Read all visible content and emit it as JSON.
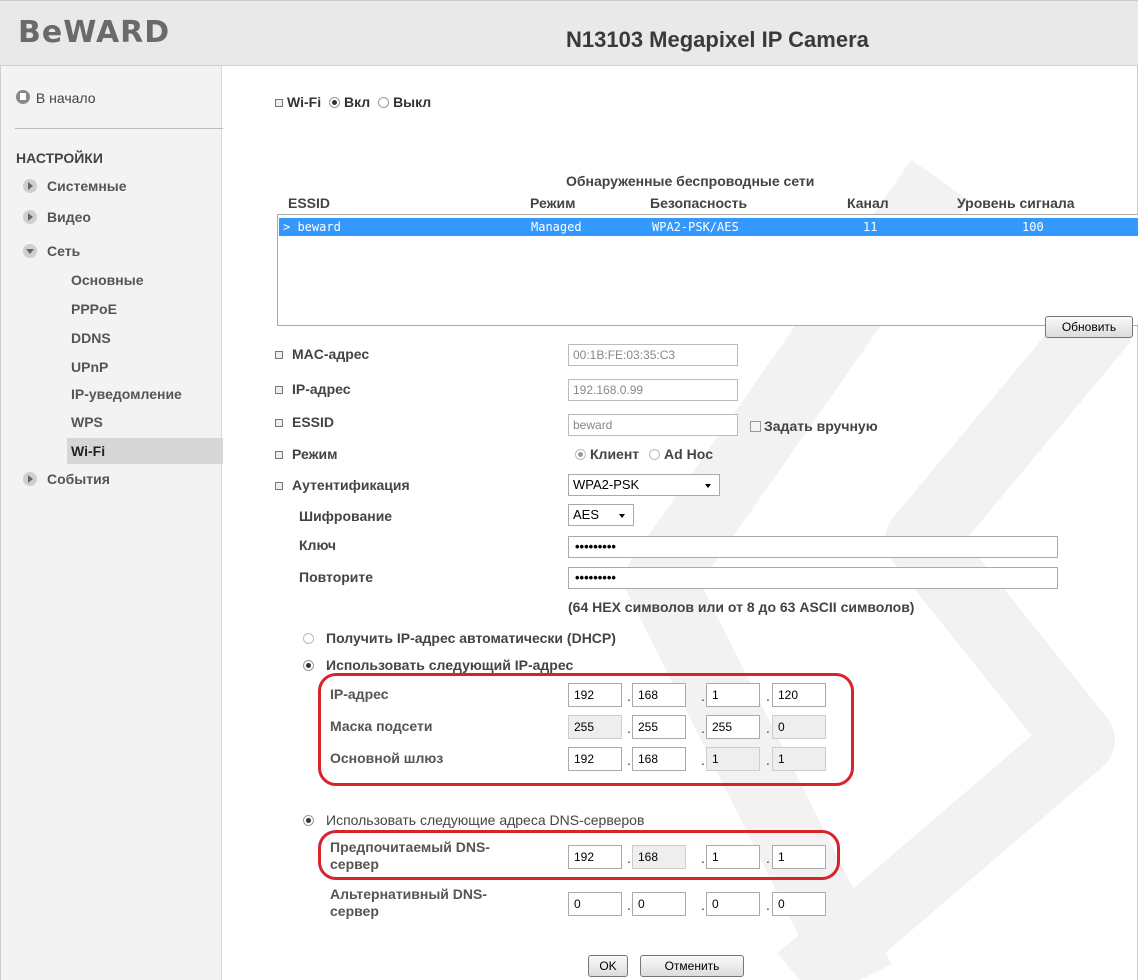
{
  "header": {
    "logo": "BeWARD",
    "title": "N13103 Megapixel IP Camera"
  },
  "sidebar": {
    "home": "В начало",
    "section": "НАСТРОЙКИ",
    "menu": [
      {
        "label": "Системные"
      },
      {
        "label": "Видео"
      },
      {
        "label": "Сеть"
      },
      {
        "label": "События"
      }
    ],
    "network_items": [
      {
        "label": "Основные"
      },
      {
        "label": "PPPoE"
      },
      {
        "label": "DDNS"
      },
      {
        "label": "UPnP"
      },
      {
        "label": "IP-уведомление"
      },
      {
        "label": "WPS"
      },
      {
        "label": "Wi-Fi"
      }
    ]
  },
  "wifi": {
    "label": "Wi-Fi",
    "on": "Вкл",
    "off": "Выкл",
    "state": "on"
  },
  "networks": {
    "caption": "Обнаруженные беспроводные сети",
    "headers": {
      "essid": "ESSID",
      "mode": "Режим",
      "security": "Безопасность",
      "channel": "Канал",
      "signal": "Уровень сигнала"
    },
    "rows": [
      {
        "essid": "> beward",
        "mode": "Managed",
        "security": "WPA2-PSK/AES",
        "channel": "11",
        "signal": "100"
      }
    ],
    "refresh_button": "Обновить"
  },
  "form": {
    "mac_label": "MAC-адрес",
    "mac_value": "00:1B:FE:03:35:C3",
    "ip_label": "IP-адрес",
    "ip_value": "192.168.0.99",
    "essid_label": "ESSID",
    "essid_value": "beward",
    "manual_label": "Задать вручную",
    "mode_label": "Режим",
    "mode_client": "Клиент",
    "mode_adhoc": "Ad Hoc",
    "auth_label": "Аутентификация",
    "auth_value": "WPA2-PSK",
    "enc_label": "Шифрование",
    "enc_value": "AES",
    "key_label": "Ключ",
    "key_value": "•••••••••",
    "repeat_label": "Повторите",
    "repeat_value": "•••••••••",
    "hint": "(64 HEX символов или от 8 до 63 ASCII символов)"
  },
  "ipconfig": {
    "dhcp": "Получить IP-адрес автоматически (DHCP)",
    "static": "Использовать следующий IP-адрес",
    "ip_label": "IP-адрес",
    "ip": [
      "192",
      "168",
      "1",
      "120"
    ],
    "mask_label": "Маска подсети",
    "mask": [
      "255",
      "255",
      "255",
      "0"
    ],
    "gw_label": "Основной шлюз",
    "gw": [
      "192",
      "168",
      "1",
      "1"
    ]
  },
  "dns": {
    "option": "Использовать следующие адреса DNS-серверов",
    "pref_label_1": "Предпочитаемый DNS-",
    "pref_label_2": "сервер",
    "pref": [
      "192",
      "168",
      "1",
      "1"
    ],
    "alt_label_1": "Альтернативный DNS-",
    "alt_label_2": "сервер",
    "alt": [
      "0",
      "0",
      "0",
      "0"
    ]
  },
  "buttons": {
    "ok": "OK",
    "cancel": "Отменить"
  },
  "colors": {
    "highlight": "#3399ff",
    "annotation": "#d8232a",
    "active_menu": "#d6d6d6"
  }
}
